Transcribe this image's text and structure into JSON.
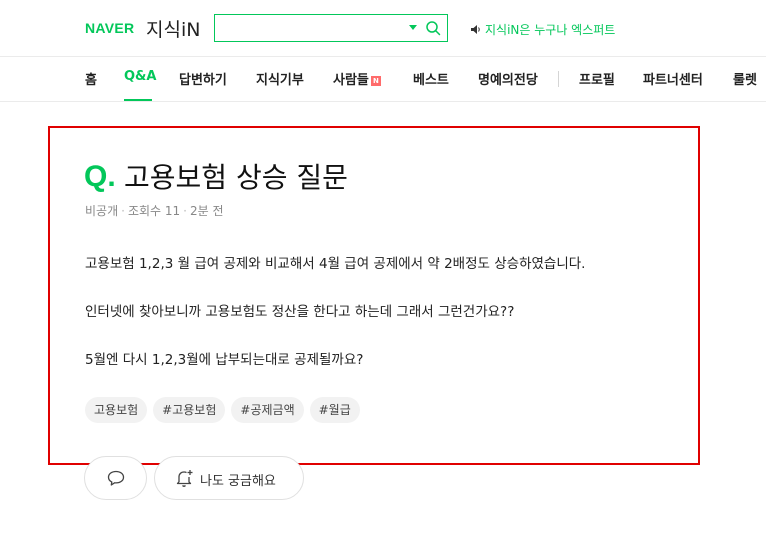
{
  "header": {
    "logo_naver": "NAVER",
    "logo_service": "지식iN",
    "search_value": "",
    "promo_text": "지식iN은 누구나 엑스퍼트"
  },
  "nav": {
    "items": [
      {
        "label": "홈",
        "active": false
      },
      {
        "label": "Q&A",
        "active": true
      },
      {
        "label": "답변하기",
        "active": false
      },
      {
        "label": "지식기부",
        "active": false
      },
      {
        "label": "사람들",
        "active": false,
        "badge": "N"
      },
      {
        "label": "베스트",
        "active": false
      },
      {
        "label": "명예의전당",
        "active": false
      },
      {
        "label": "프로필",
        "active": false
      },
      {
        "label": "파트너센터",
        "active": false
      },
      {
        "label": "룰렛",
        "active": false
      }
    ]
  },
  "question": {
    "q_mark": "Q.",
    "title": "고용보험 상승 질문",
    "meta": {
      "visibility": "비공개",
      "views": "조회수 11",
      "time": "2분 전"
    },
    "body": [
      "고용보험 1,2,3 월 급여 공제와 비교해서 4월 급여 공제에서 약 2배정도 상승하였습니다.",
      "인터넷에 찾아보니까 고용보험도 정산을 한다고 하는데 그래서 그런건가요??",
      "5월엔 다시 1,2,3월에 납부되는대로 공제될까요?"
    ],
    "tags": [
      "고용보험",
      "#고용보험",
      "#공제금액",
      "#월급"
    ]
  },
  "actions": {
    "curious_label": "나도 궁금해요"
  },
  "colors": {
    "brand_green": "#03c75a",
    "highlight_box": "#e00000",
    "badge_red": "#ff6b6b"
  }
}
